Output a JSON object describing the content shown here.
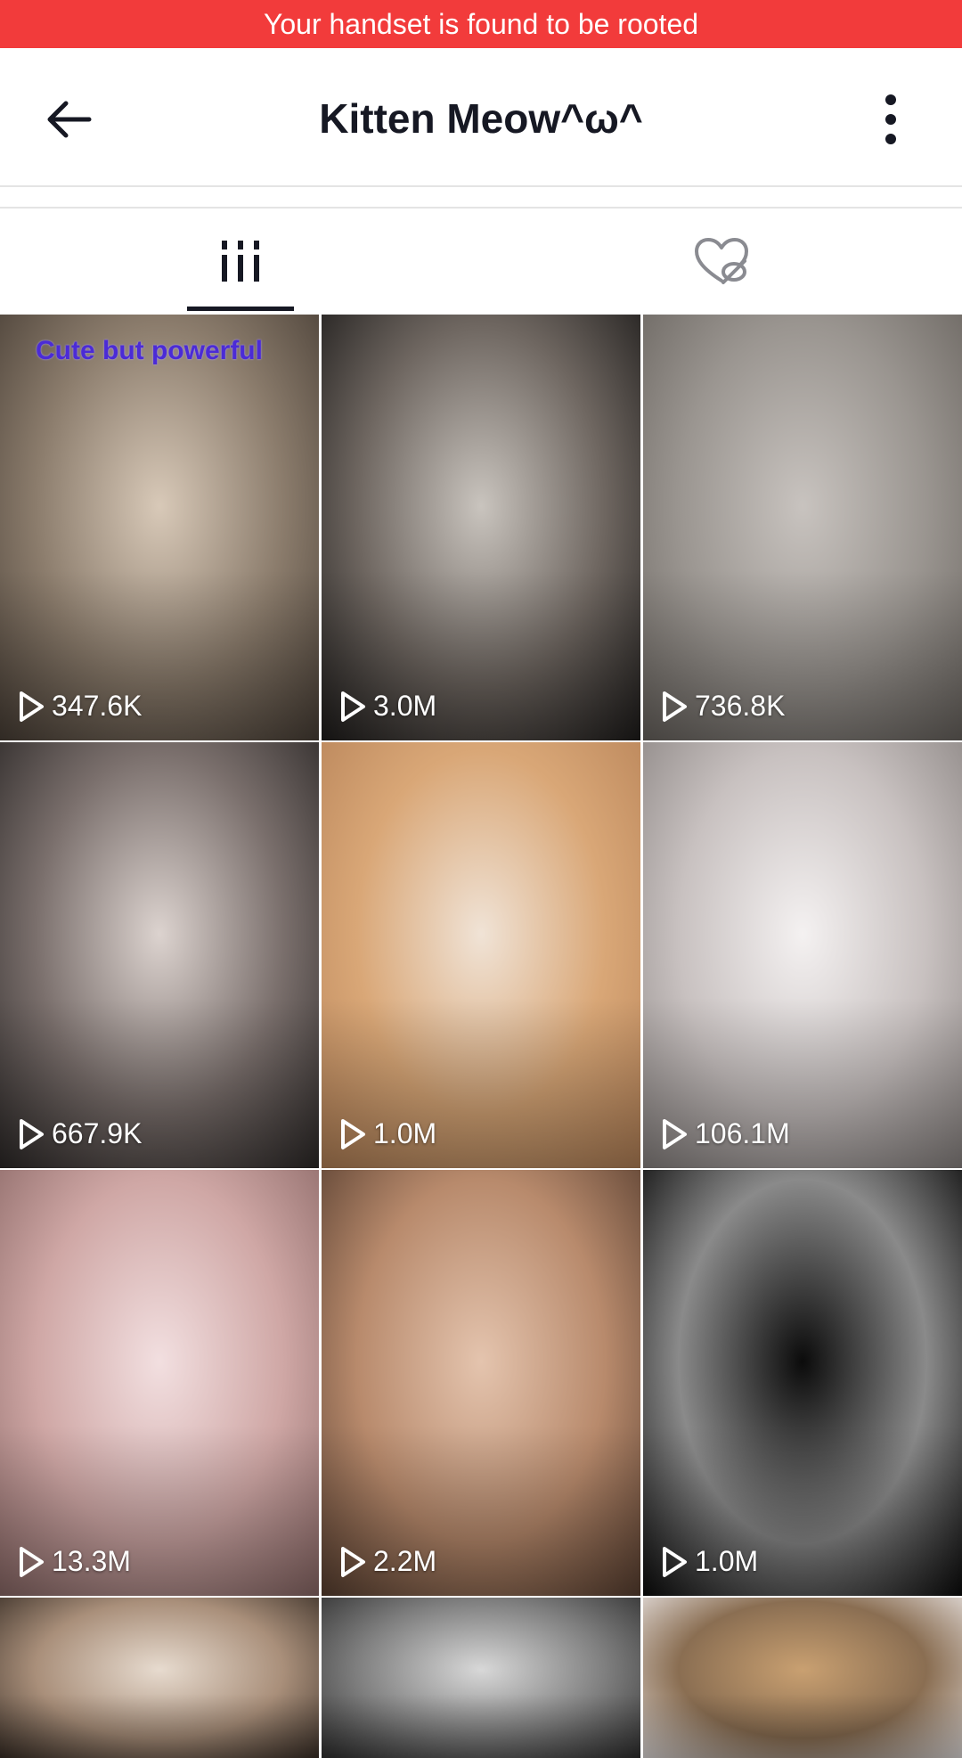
{
  "banner": {
    "text": "Your handset is found to be rooted",
    "color": "#f23b3b"
  },
  "header": {
    "title": "Kitten Meow^ω^",
    "back_icon": "arrow-left-icon",
    "more_icon": "vertical-dots-icon"
  },
  "tabs": [
    {
      "name": "videos",
      "icon": "grid-columns-icon",
      "active": true
    },
    {
      "name": "liked",
      "icon": "heart-hidden-icon",
      "active": false
    }
  ],
  "videos": [
    {
      "views": "347.6K",
      "caption": "Cute but powerful",
      "colors": [
        "#d8c9b8",
        "#8b7c6c",
        "#4a4037"
      ]
    },
    {
      "views": "3.0M",
      "caption": "",
      "colors": [
        "#c9c4be",
        "#6e6660",
        "#1e1c1b"
      ]
    },
    {
      "views": "736.8K",
      "caption": "",
      "colors": [
        "#c8c3bf",
        "#9a9590",
        "#6b6661"
      ]
    },
    {
      "views": "667.9K",
      "caption": "",
      "colors": [
        "#dcd3cf",
        "#7a6f6c",
        "#2e2a29"
      ]
    },
    {
      "views": "1.0M",
      "caption": "",
      "colors": [
        "#f0e3d6",
        "#d9a777",
        "#b9855a"
      ]
    },
    {
      "views": "106.1M",
      "caption": "",
      "colors": [
        "#f4f1f1",
        "#c8c1c0",
        "#8d8785"
      ]
    },
    {
      "views": "13.3M",
      "caption": "",
      "colors": [
        "#f2dfe0",
        "#cfa7a5",
        "#8f6c6a"
      ]
    },
    {
      "views": "2.2M",
      "caption": "",
      "colors": [
        "#e4c4ae",
        "#b88a6c",
        "#5b4132"
      ]
    },
    {
      "views": "1.0M",
      "caption": "",
      "colors": [
        "#0b0b0b",
        "#8a8a8a",
        "#0b0b0b"
      ]
    },
    {
      "views": "",
      "caption": "",
      "colors": [
        "#e7dbcf",
        "#a98f7a",
        "#3a2f27"
      ]
    },
    {
      "views": "",
      "caption": "",
      "colors": [
        "#d8d8d8",
        "#7f7f7f",
        "#2f2f2f"
      ]
    },
    {
      "views": "",
      "caption": "",
      "colors": [
        "#c9a071",
        "#8a6e52",
        "#e8e3e2"
      ]
    }
  ]
}
